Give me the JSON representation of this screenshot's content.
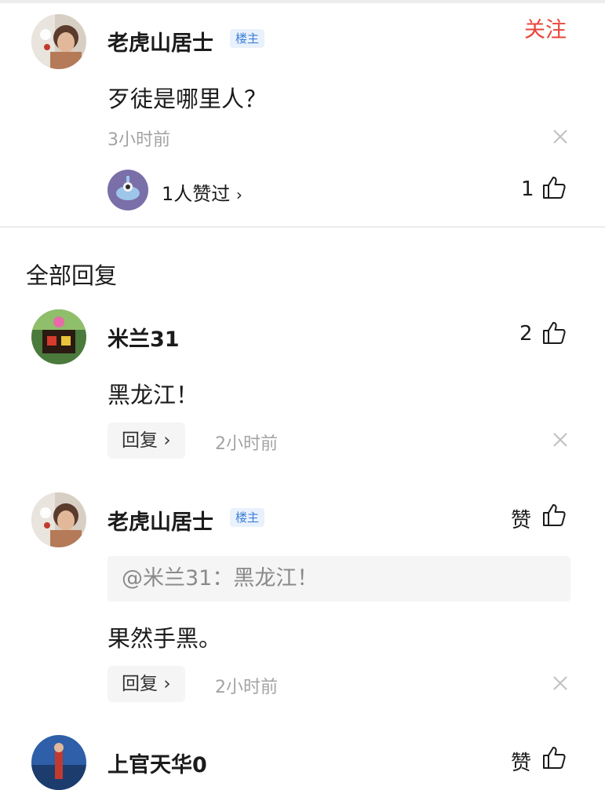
{
  "main_post": {
    "author": "老虎山居士",
    "badge": "楼主",
    "follow": "关注",
    "content": "歹徒是哪里人？",
    "time": "3小时前",
    "liked_by": "1人赞过",
    "like_count": "1"
  },
  "replies_section": {
    "title": "全部回复"
  },
  "replies": [
    {
      "author": "米兰31",
      "like_count": "2",
      "content": "黑龙江！",
      "reply_label": "回复",
      "time": "2小时前"
    },
    {
      "author": "老虎山居士",
      "badge": "楼主",
      "like_label": "赞",
      "quote": "@米兰31：黑龙江！",
      "content": "果然手黑。",
      "reply_label": "回复",
      "time": "2小时前"
    },
    {
      "author": "上官天华0",
      "like_label": "赞"
    }
  ],
  "colors": {
    "follow": "#e8463b",
    "badge_text": "#3d7fd8",
    "badge_bg": "#e9f1fc",
    "muted": "#a3a3a3"
  },
  "icons": [
    "thumbs-up-icon",
    "close-icon",
    "chevron-right-icon"
  ]
}
